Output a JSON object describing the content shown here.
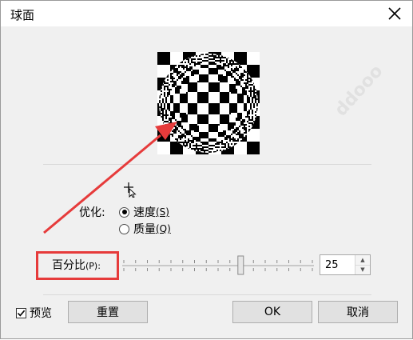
{
  "dialog": {
    "title": "球面",
    "close_icon": "close-icon"
  },
  "preview": {
    "icon": "checkerboard-sphere-preview"
  },
  "optimization": {
    "label": "优化:",
    "options": [
      {
        "label": "速度",
        "hotkey": "(S)",
        "selected": true
      },
      {
        "label": "质量",
        "hotkey": "(Q)",
        "selected": false
      }
    ]
  },
  "percent": {
    "label": "百分比",
    "hotkey": "(P):",
    "value": "25",
    "slider_fraction": 0.62,
    "highlight_color": "#e63b3b"
  },
  "footer": {
    "preview_label": "预览",
    "preview_checked": true,
    "reset_label": "重置",
    "ok_label": "OK",
    "cancel_label": "取消"
  },
  "colors": {
    "accent": "#e63b3b",
    "dialog_bg": "#f0f0f0",
    "button_bg": "#e1e1e1"
  }
}
